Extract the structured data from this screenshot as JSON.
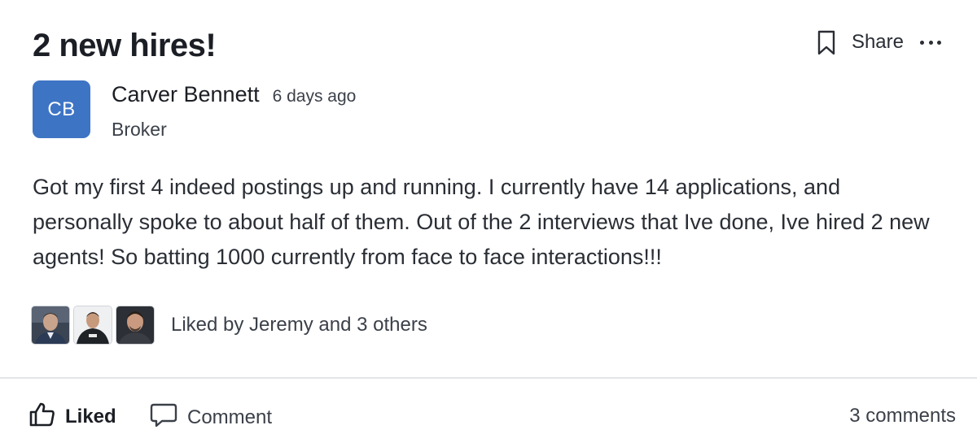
{
  "post": {
    "title": "2 new hires!",
    "author": {
      "initials": "CB",
      "name": "Carver Bennett",
      "role": "Broker",
      "avatar_color": "#3e74c4"
    },
    "time_ago": "6 days ago",
    "body": "Got my first 4 indeed postings up and running. I currently have 14 applications, and personally spoke to about half of them. Out of the 2 interviews that Ive done, Ive hired 2 new agents! So batting 1000 currently from face to face interactions!!!"
  },
  "header_actions": {
    "bookmark_icon": "bookmark-icon",
    "share_label": "Share",
    "more_icon": "more-horizontal-icon"
  },
  "likes": {
    "text": "Liked by Jeremy and 3 others",
    "avatar_count": 3
  },
  "footer": {
    "liked_label": "Liked",
    "liked_icon": "thumbs-up-icon",
    "comment_label": "Comment",
    "comment_icon": "comment-icon",
    "comments_count_label": "3 comments"
  }
}
